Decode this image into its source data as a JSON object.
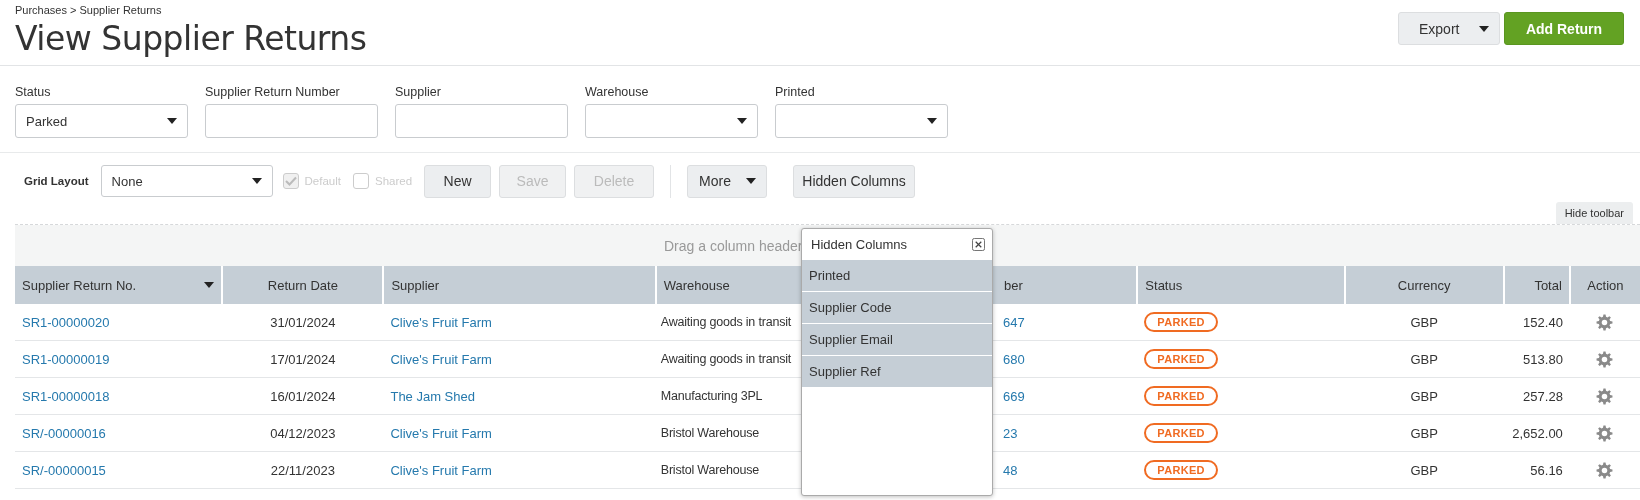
{
  "breadcrumb": "Purchases > Supplier Returns",
  "title": "View Supplier Returns",
  "header_buttons": [
    {
      "label": "Export",
      "kind": "dropdown"
    },
    {
      "label": "Add Return",
      "kind": "primary"
    }
  ],
  "filters": [
    {
      "label": "Status",
      "kind": "select",
      "value": "Parked"
    },
    {
      "label": "Supplier Return Number",
      "kind": "text"
    },
    {
      "label": "Supplier",
      "kind": "text"
    },
    {
      "label": "Warehouse",
      "kind": "select"
    },
    {
      "label": "Printed",
      "kind": "select"
    }
  ],
  "toolbar": {
    "grid_layout_label": "Grid Layout",
    "grid_layout_value": "None",
    "checkboxes": [
      {
        "label": "Default",
        "checked": true,
        "disabled": true
      },
      {
        "label": "Shared",
        "checked": false,
        "disabled": true
      }
    ],
    "buttons": [
      {
        "label": "New",
        "disabled": false
      },
      {
        "label": "Save",
        "disabled": true
      },
      {
        "label": "Delete",
        "disabled": true
      }
    ],
    "more_button": "More",
    "hidden_columns_button": "Hidden Columns",
    "hide_toolbar": "Hide toolbar"
  },
  "group_hint": "Drag a column header",
  "table": {
    "columns": [
      {
        "label": "Supplier Return No.",
        "sort": true
      },
      {
        "label": "Return Date",
        "sort": false
      },
      {
        "label": "Supplier",
        "sort": false
      },
      {
        "label": "Warehouse",
        "sort": false
      },
      {
        "label": "ber",
        "sort": false
      },
      {
        "label": "Status",
        "sort": false
      },
      {
        "label": "Currency",
        "sort": false
      },
      {
        "label": "Total",
        "sort": false
      },
      {
        "label": "Action",
        "sort": false
      }
    ],
    "rows": [
      {
        "number": "SR1-00000020",
        "date": "31/01/2024",
        "supplier": "Clive's Fruit Farm",
        "warehouse": "Awaiting goods in transit",
        "column_5": "647",
        "status": "PARKED",
        "currency": "GBP",
        "total": "152.40"
      },
      {
        "number": "SR1-00000019",
        "date": "17/01/2024",
        "supplier": "Clive's Fruit Farm",
        "warehouse": "Awaiting goods in transit",
        "column_5": "680",
        "status": "PARKED",
        "currency": "GBP",
        "total": "513.80"
      },
      {
        "number": "SR1-00000018",
        "date": "16/01/2024",
        "supplier": "The Jam Shed",
        "warehouse": "Manufacturing 3PL",
        "column_5": "669",
        "status": "PARKED",
        "currency": "GBP",
        "total": "257.28"
      },
      {
        "number": "SR/-00000016",
        "date": "04/12/2023",
        "supplier": "Clive's Fruit Farm",
        "warehouse": "Bristol Warehouse",
        "column_5": "23",
        "status": "PARKED",
        "currency": "GBP",
        "total": "2,652.00"
      },
      {
        "number": "SR/-00000015",
        "date": "22/11/2023",
        "supplier": "Clive's Fruit Farm",
        "warehouse": "Bristol Warehouse",
        "column_5": "48",
        "status": "PARKED",
        "currency": "GBP",
        "total": "56.16"
      }
    ]
  },
  "hidden_columns_popup": {
    "title": "Hidden Columns",
    "items": [
      "Printed",
      "Supplier Code",
      "Supplier Email",
      "Supplier Ref"
    ]
  }
}
